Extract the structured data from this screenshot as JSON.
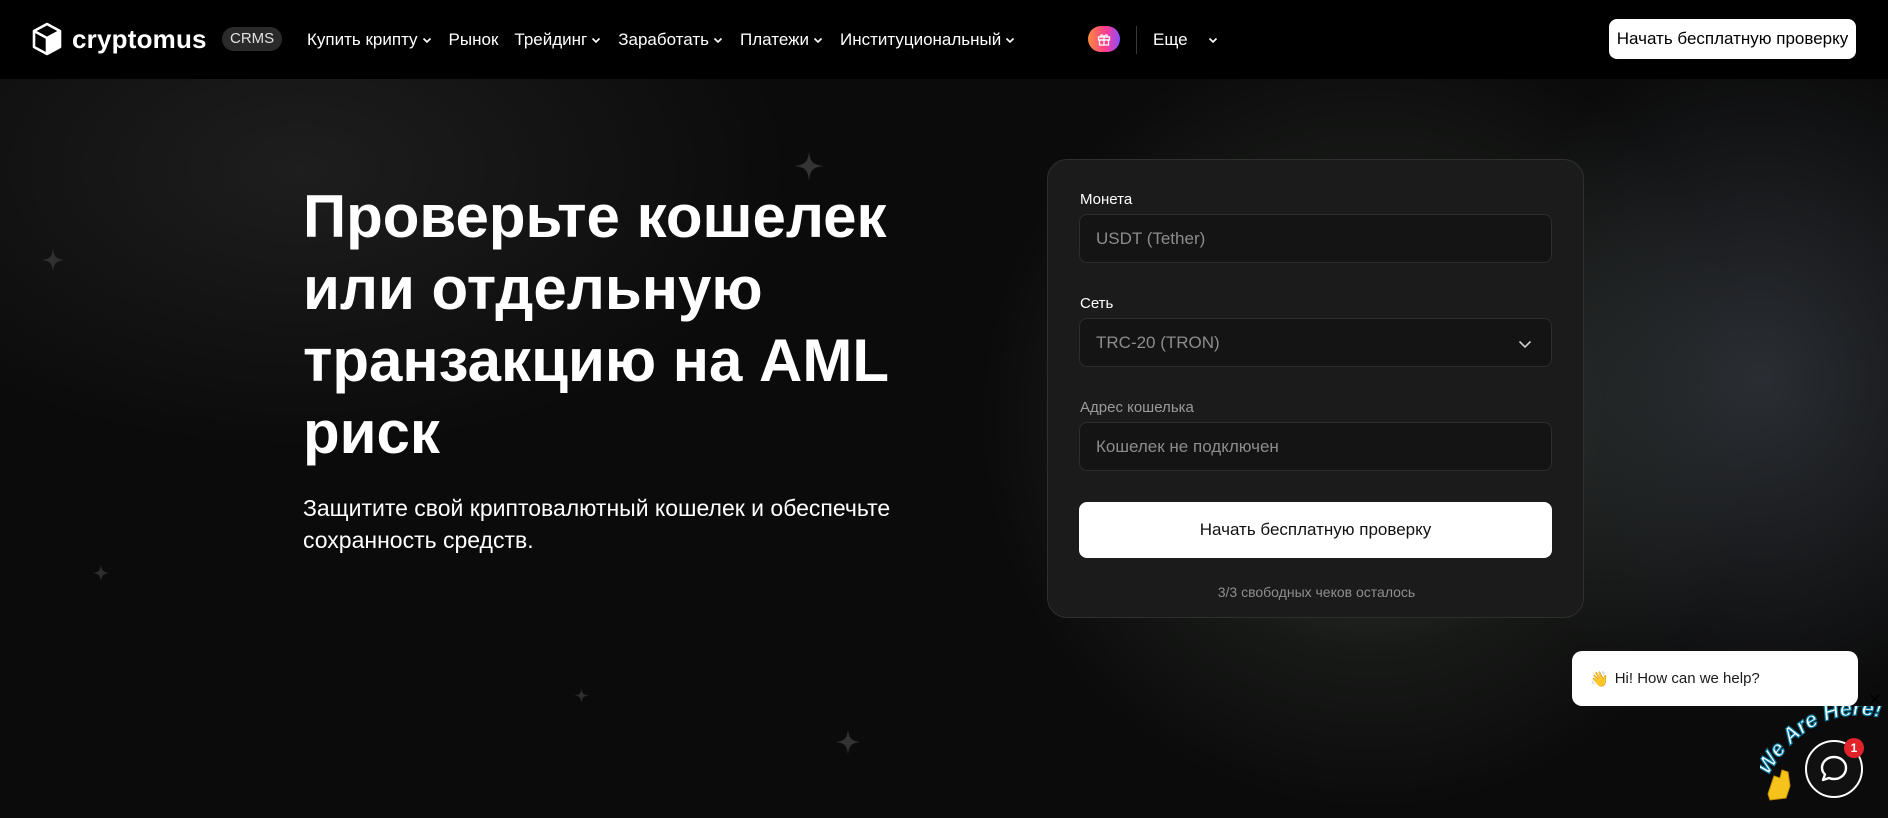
{
  "header": {
    "brand": "cryptomus",
    "badge": "CRMS",
    "nav": [
      {
        "label": "Купить крипту",
        "dropdown": true
      },
      {
        "label": "Рынок",
        "dropdown": false
      },
      {
        "label": "Трейдинг",
        "dropdown": true
      },
      {
        "label": "Заработать",
        "dropdown": true
      },
      {
        "label": "Платежи",
        "dropdown": true
      },
      {
        "label": "Институциональный",
        "dropdown": true
      }
    ],
    "more_label": "Еще",
    "cta_label": "Начать бесплатную проверку"
  },
  "hero": {
    "title": "Проверьте кошелек или отдельную транзакцию на AML риск",
    "subtitle": "Защитите свой криптовалютный кошелек и обеспечьте сохранность средств."
  },
  "form": {
    "coin_label": "Монета",
    "coin_value": "USDT (Tether)",
    "network_label": "Сеть",
    "network_value": "TRC-20 (TRON)",
    "address_label": "Адрес кошелька",
    "address_placeholder": "Кошелек не подключен",
    "submit_label": "Начать бесплатную проверку",
    "checks_left": "3/3 свободных чеков осталось"
  },
  "chat": {
    "greeting_emoji": "👋",
    "greeting": "Hi! How can we help?",
    "close": "✕",
    "banner": "We Are Here!",
    "unread_count": "1"
  },
  "colors": {
    "background": "#0b0b0b",
    "card": "#1b1b1b",
    "badge_red": "#e2232a"
  }
}
